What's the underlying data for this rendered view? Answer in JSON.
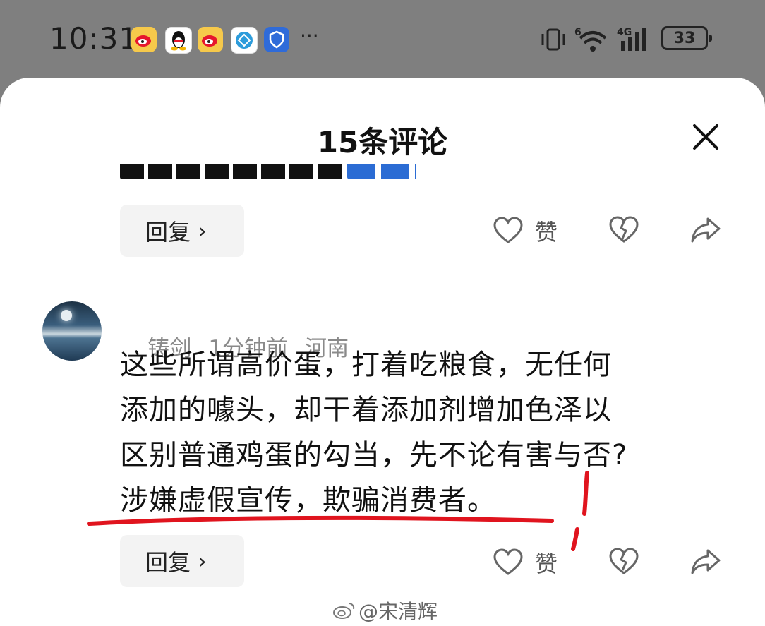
{
  "status_bar": {
    "time": "10:31",
    "app_icons": [
      "weibo-icon",
      "qq-icon",
      "weibo-icon",
      "browser-icon",
      "shield-app-icon"
    ],
    "more": "···",
    "signal_label": "4G",
    "wifi_label": "6",
    "battery": "33"
  },
  "sheet": {
    "title": "15条评论",
    "close_icon": "close-icon"
  },
  "comment1_actions": {
    "reply_label": "回复",
    "like_label": "赞"
  },
  "comment2": {
    "username": "铸剑",
    "time_ago": "1分钟前",
    "location": "河南",
    "lines": [
      "这些所谓高价蛋，打着吃粮食，无任何",
      "添加的噱头，却干着添加剂增加色泽以",
      "区别普通鸡蛋的勾当，先不论有害与否?",
      "涉嫌虚假宣传，欺骗消费者。"
    ],
    "reply_label": "回复",
    "like_label": "赞"
  },
  "watermark": {
    "text": "@宋清辉"
  },
  "colors": {
    "overlay": "#7f7f7f",
    "annotation_red": "#e0141e"
  }
}
